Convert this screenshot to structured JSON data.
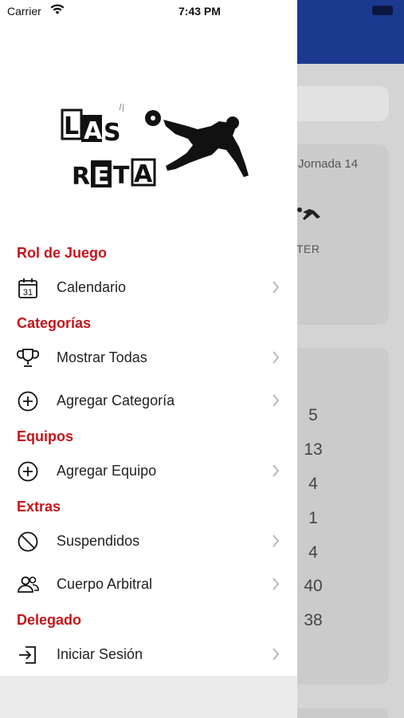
{
  "status_bar": {
    "carrier": "Carrier",
    "time": "7:43 PM"
  },
  "background": {
    "jornada": "Jornada 14",
    "partial_label": "TER",
    "numbers": [
      "5",
      "13",
      "4",
      "1",
      "4",
      "40",
      "38"
    ]
  },
  "menu": {
    "sections": [
      {
        "title": "Rol de Juego"
      },
      {
        "title": "Categorías"
      },
      {
        "title": "Equipos"
      },
      {
        "title": "Extras"
      },
      {
        "title": "Delegado"
      }
    ],
    "items": [
      {
        "label": "Calendario",
        "icon": "calendar-icon",
        "calendar_day": "31"
      },
      {
        "label": "Mostrar Todas",
        "icon": "trophy-icon"
      },
      {
        "label": "Agregar Categoría",
        "icon": "plus-circle-icon"
      },
      {
        "label": "Agregar Equipo",
        "icon": "plus-circle-icon"
      },
      {
        "label": "Suspendidos",
        "icon": "prohibited-icon"
      },
      {
        "label": "Cuerpo Arbitral",
        "icon": "people-icon"
      },
      {
        "label": "Iniciar Sesión",
        "icon": "login-icon"
      }
    ]
  },
  "colors": {
    "accent": "#c4161c",
    "header": "#1b3a8f"
  }
}
